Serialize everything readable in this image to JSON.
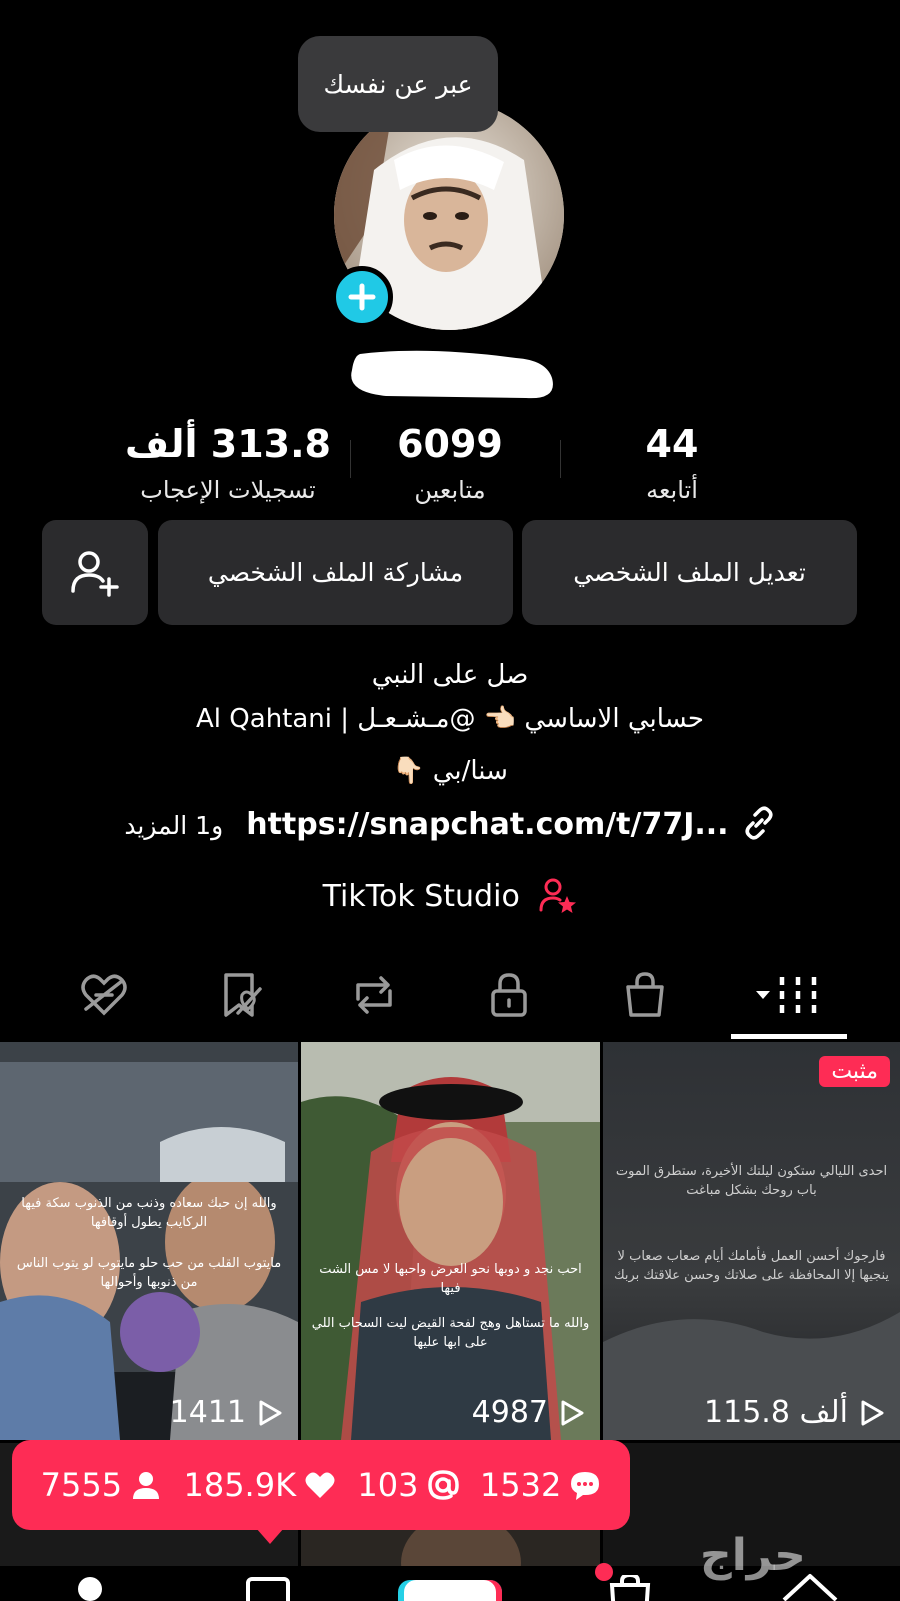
{
  "profile": {
    "bubble_text": "عبر عن نفسك",
    "stats": {
      "likes_value": "313.8 ألف",
      "likes_label": "تسجيلات الإعجاب",
      "followers_value": "6099",
      "followers_label": "متابعين",
      "following_value": "44",
      "following_label": "أتابعه"
    },
    "buttons": {
      "edit_label": "تعديل الملف الشخصي",
      "share_label": "مشاركة الملف الشخصي"
    },
    "bio": {
      "line1": "صل على النبي",
      "line2": "حسابي الاساسي 👈🏻 @مـشـعـل | Al Qahtani",
      "line3": "سنا/بي 👇🏻",
      "link_url": "https://snapchat.com/t/77J...",
      "link_more": "و1 المزيد"
    },
    "studio_label": "TikTok Studio"
  },
  "tabs": [
    {
      "icon": "videos-grid-icon",
      "active": true
    },
    {
      "icon": "shop-bag-icon"
    },
    {
      "icon": "private-lock-icon"
    },
    {
      "icon": "repost-icon"
    },
    {
      "icon": "favorites-icon"
    },
    {
      "icon": "liked-icon"
    }
  ],
  "videos": [
    {
      "views": "1411",
      "caption_top": "والله إن حبك سعاده وذنب من الذنوب سكة فيها الركايب يطول أوقافها",
      "caption_bottom": "مايتوب القلب من حب حلو مايتوب لو يتوب الناس من ذنوبها وأحوالها"
    },
    {
      "views": "4987",
      "caption_top": "احب نجد و دوبها نحو العرض واحبها لا مس الشت فيها",
      "caption_bottom": "والله ما تستاهل وهج لفحة القيض ليت السحاب اللي على ابها عليها"
    },
    {
      "views": "115.8 ألف",
      "pinned_label": "مثبت",
      "caption_top": "احدى الليالي ستكون ليلتك الأخيرة، ستطرق الموت باب روحك بشكل مباغت",
      "caption_bottom": "فارجوك أحسن العمل فأمامك أيام صعاب صعاب لا ينجيها إلا المحافظة على صلاتك وحسن علاقتك بربك"
    }
  ],
  "notification": {
    "comments": "1532",
    "mentions": "103",
    "likes": "185.9K",
    "followers": "7555"
  },
  "watermark": "حراج",
  "colors": {
    "accent": "#fe2c55",
    "badge": "#20c9e6",
    "button_bg": "#2b2b2d"
  }
}
